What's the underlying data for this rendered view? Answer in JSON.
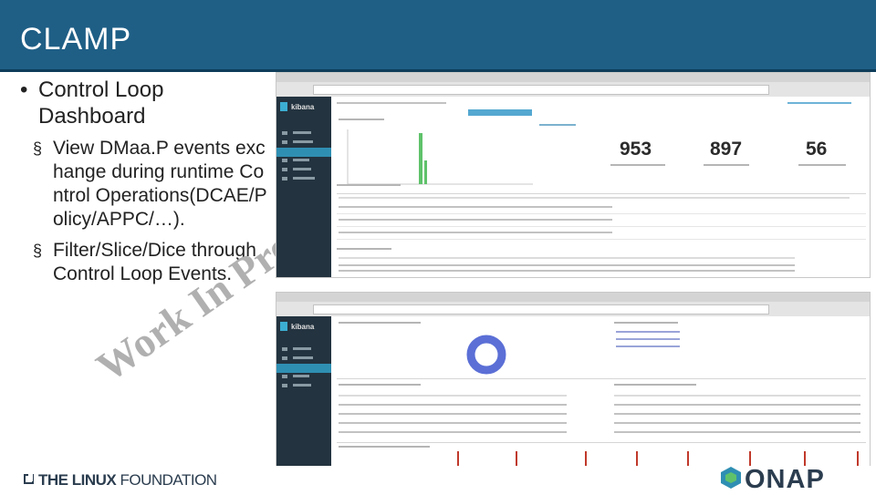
{
  "slide": {
    "title": "CLAMP",
    "bullets": [
      {
        "text": "Control Loop Dashboard",
        "level": 1
      },
      {
        "text": "View DMaa.P events exchange during runtime Control Operations(DCAE/Policy/APPC/…).",
        "level": 2
      },
      {
        "text": "Filter/Slice/Dice through Control Loop Events.",
        "level": 2
      }
    ],
    "bullet_glyph_l1": "•",
    "bullet_glyph_l2": "§",
    "watermark": "Work In Progress"
  },
  "screenshot_top": {
    "sidebar_brand": "kibana",
    "stats": [
      {
        "value": "953"
      },
      {
        "value": "897"
      },
      {
        "value": "56"
      }
    ]
  },
  "screenshot_bottom": {
    "sidebar_brand": "kibana"
  },
  "footer": {
    "linux_foundation_bold": "THE LINUX",
    "linux_foundation_light": " FOUNDATION",
    "onap": "ONAP"
  },
  "colors": {
    "header": "#1f5f86",
    "sidebar": "#23333f",
    "accent": "#3caed2",
    "bar_green": "#5fc26b",
    "bar_red": "#c0392b",
    "donut": "#5b6fd6"
  }
}
